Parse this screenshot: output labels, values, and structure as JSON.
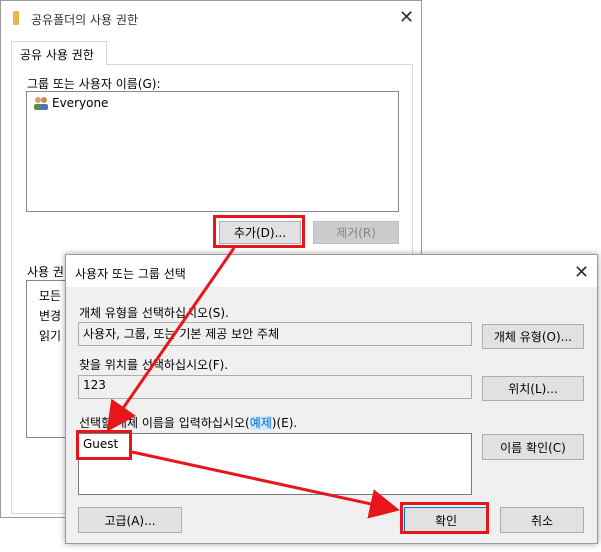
{
  "back": {
    "title": "공유폴더의 사용 권한",
    "tab": "공유 사용 권한",
    "group_label": "그룹 또는 사용자 이름(G):",
    "users": [
      "Everyone"
    ],
    "add_button": "추가(D)...",
    "remove_button": "제거(R)",
    "perm_label": "사용 권",
    "perm_items": [
      "모든",
      "변경",
      "읽기"
    ]
  },
  "front": {
    "title": "사용자 또는 그룹 선택",
    "obj_type_label": "개체 유형을 선택하십시오(S).",
    "obj_type_value": "사용자, 그룹, 또는 기본 제공 보안 주체",
    "obj_type_button": "개체 유형(O)...",
    "location_label": "찾을 위치를 선택하십시오(F).",
    "location_value": "123",
    "location_button": "위치(L)...",
    "name_label_pre": "선택할 개체 이름을 입력하십시오(",
    "name_label_link": "예제",
    "name_label_post": ")(E).",
    "name_value": "Guest",
    "check_button": "이름 확인(C)",
    "advanced_button": "고급(A)...",
    "ok_button": "확인",
    "cancel_button": "취소"
  },
  "colors": {
    "highlight": "#e8161b",
    "link": "#0066cc"
  }
}
